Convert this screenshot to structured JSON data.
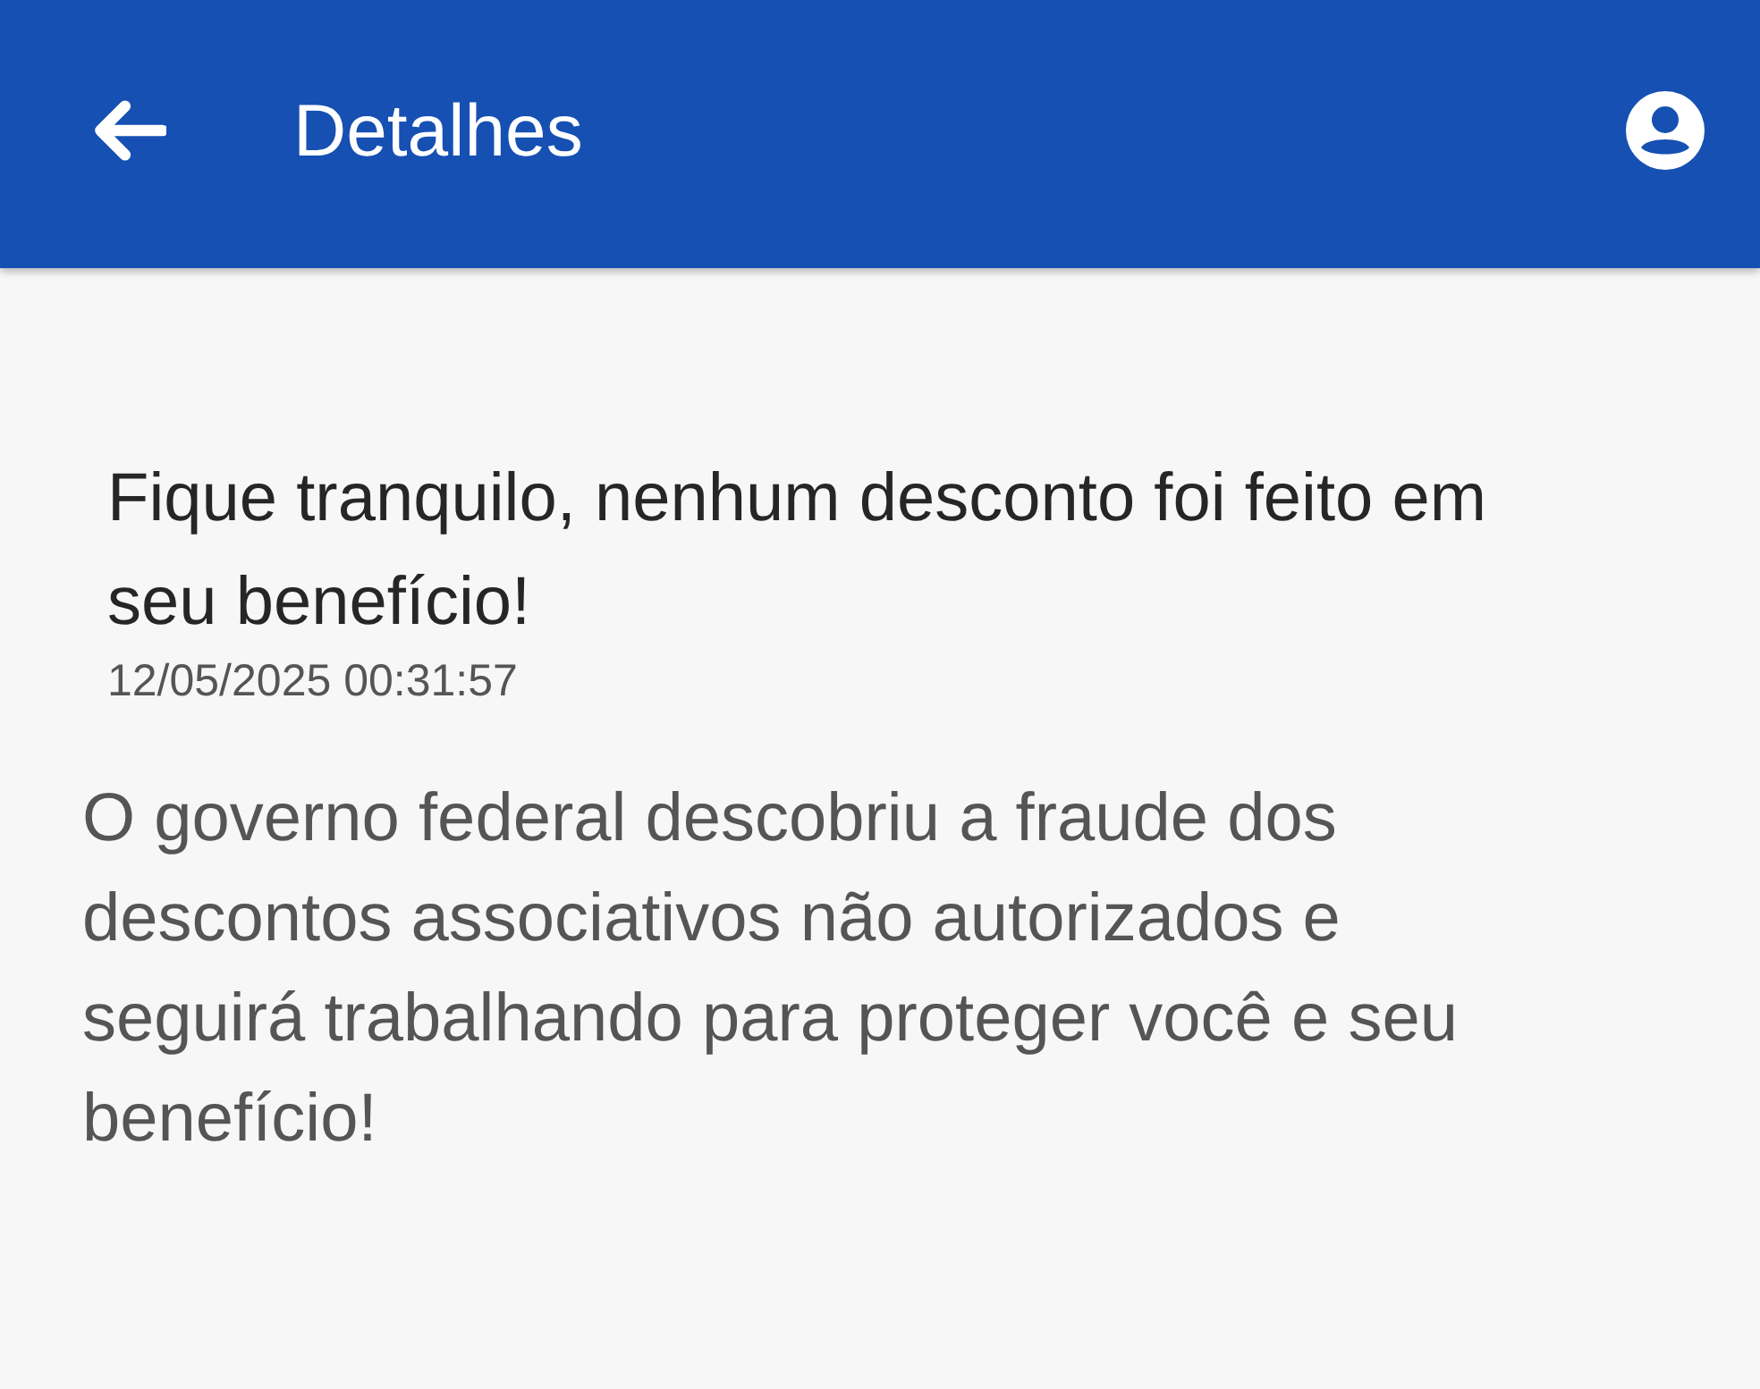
{
  "app_bar": {
    "title": "Detalhes"
  },
  "notification": {
    "title": "Fique tranquilo, nenhum desconto foi feito em seu benefício!",
    "timestamp": "12/05/2025 00:31:57",
    "body": "O governo federal descobriu a fraude dos descontos associativos não autorizados e seguirá trabalhando para proteger você e seu benefício!"
  }
}
